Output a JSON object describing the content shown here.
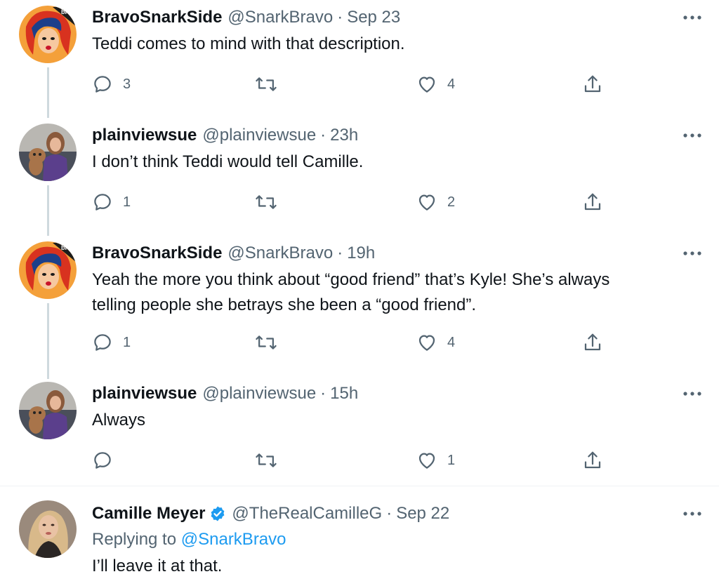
{
  "tweets": [
    {
      "name": "BravoSnarkSide",
      "handle": "@SnarkBravo",
      "dot": "·",
      "time": "Sep 23",
      "text": "Teddi comes to mind with that description.",
      "reply_count": "3",
      "retweet_count": "",
      "like_count": "4"
    },
    {
      "name": "plainviewsue",
      "handle": "@plainviewsue",
      "dot": "·",
      "time": "23h",
      "text": "I don’t think Teddi would tell Camille.",
      "reply_count": "1",
      "retweet_count": "",
      "like_count": "2"
    },
    {
      "name": "BravoSnarkSide",
      "handle": "@SnarkBravo",
      "dot": "·",
      "time": "19h",
      "text_line1": "Yeah the more you think about “good friend” that’s Kyle! She’s always",
      "text_line2": "telling people she betrays she been a “good friend”.",
      "reply_count": "1",
      "retweet_count": "",
      "like_count": "4"
    },
    {
      "name": "plainviewsue",
      "handle": "@plainviewsue",
      "dot": "·",
      "time": "15h",
      "text": "Always",
      "reply_count": "",
      "retweet_count": "",
      "like_count": "1"
    },
    {
      "name": "Camille Meyer",
      "handle": "@TheRealCamilleG",
      "dot": "·",
      "time": "Sep 22",
      "replying_prefix": "Replying to",
      "replying_mention": "@SnarkBravo",
      "text": "I’ll leave it at that."
    }
  ],
  "avatars": {
    "bravo_logo_line1": "bravo",
    "bravo_logo_line2": "Snark Side"
  },
  "icons": {
    "more": "more-icon",
    "reply": "reply-icon",
    "retweet": "retweet-icon",
    "like": "like-icon",
    "share": "share-icon",
    "verified": "verified-badge-icon"
  },
  "colors": {
    "text": "#0f1419",
    "secondary": "#536471",
    "link": "#1d9bf0",
    "thread_line": "#cfd9de",
    "verified": "#1d9bf0"
  }
}
